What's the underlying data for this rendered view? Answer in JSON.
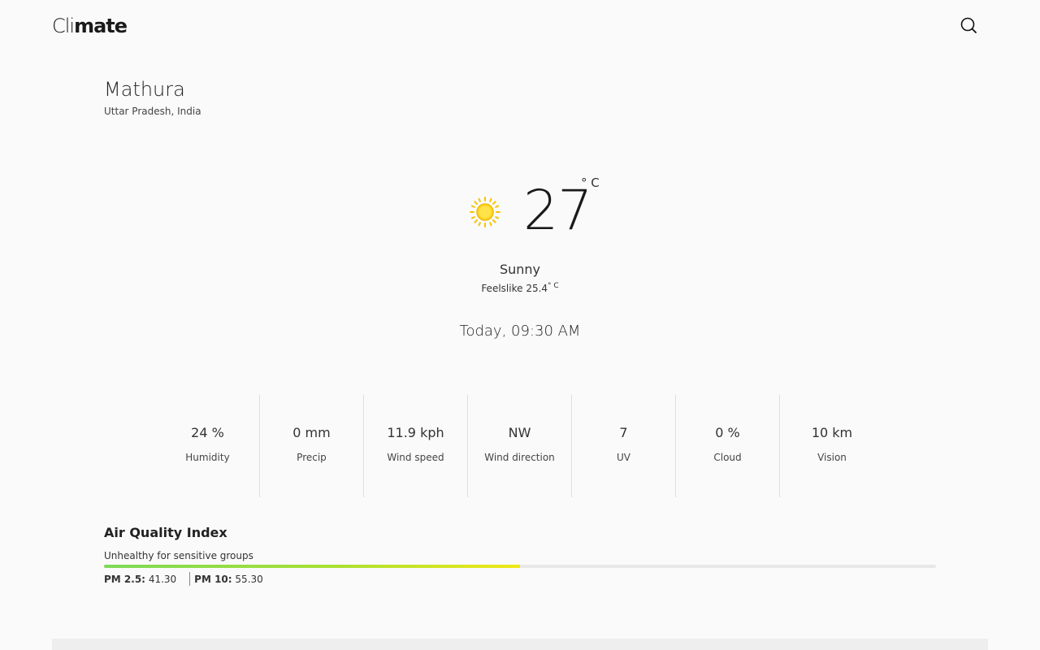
{
  "app": {
    "logo_light": "Cli",
    "logo_bold": "mate",
    "search_icon": "search-icon"
  },
  "location": {
    "city": "Mathura",
    "region": "Uttar Pradesh, India"
  },
  "current": {
    "icon": "sun-icon",
    "temperature": "27",
    "unit": "° C",
    "condition": "Sunny",
    "feelslike_label": "Feelslike",
    "feelslike_value": "25.4",
    "feelslike_unit": "° C",
    "datetime": "Today, 09:30 AM"
  },
  "stats": [
    {
      "value": "24 %",
      "label": "Humidity"
    },
    {
      "value": "0 mm",
      "label": "Precip"
    },
    {
      "value": "11.9 kph",
      "label": "Wind speed"
    },
    {
      "value": "NW",
      "label": "Wind direction"
    },
    {
      "value": "7",
      "label": "UV"
    },
    {
      "value": "0 %",
      "label": "Cloud"
    },
    {
      "value": "10 km",
      "label": "Vision"
    }
  ],
  "aqi": {
    "title": "Air Quality Index",
    "status": "Unhealthy for sensitive groups",
    "level_fraction": 0.5,
    "pm25_label": "PM 2.5:",
    "pm25_value": "41.30",
    "pm10_label": "PM 10:",
    "pm10_value": "55.30"
  },
  "colors": {
    "sun": "#f5c400",
    "aqi_start": "#7ed957",
    "aqi_end": "#f0e817"
  }
}
